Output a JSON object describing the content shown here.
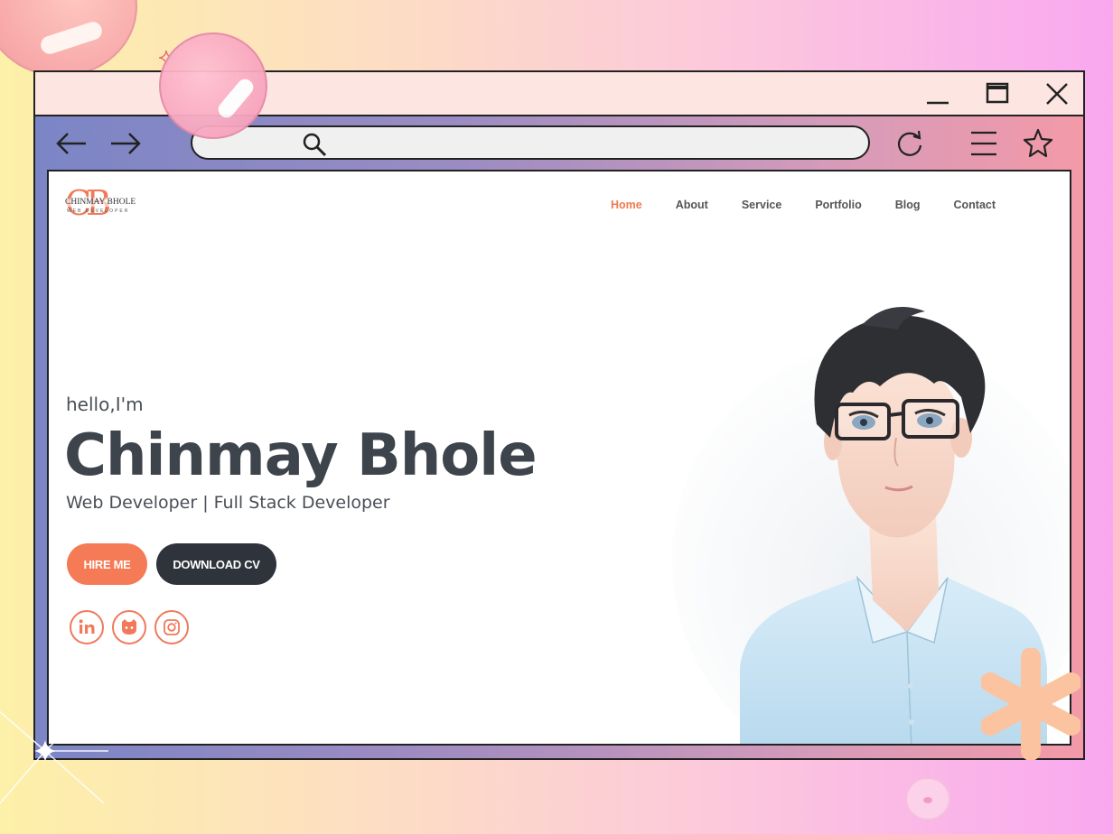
{
  "window": {
    "controls": [
      "minimize-icon",
      "maximize-icon",
      "close-icon"
    ]
  },
  "toolbar": {
    "icons": [
      "arrow-left-icon",
      "arrow-right-icon",
      "search-icon",
      "reload-icon",
      "menu-icon",
      "star-icon"
    ]
  },
  "site": {
    "logo": {
      "monogram": "CB",
      "name": "CHINMAY BHOLE",
      "tagline": "WEB DEVELOPER"
    },
    "nav": [
      {
        "label": "Home",
        "active": true
      },
      {
        "label": "About",
        "active": false
      },
      {
        "label": "Service",
        "active": false
      },
      {
        "label": "Portfolio",
        "active": false
      },
      {
        "label": "Blog",
        "active": false
      },
      {
        "label": "Contact",
        "active": false
      }
    ]
  },
  "hero": {
    "greeting": "hello,I'm",
    "name": "Chinmay Bhole",
    "role": "Web Developer | Full Stack Developer",
    "hire_label": "HIRE ME",
    "cv_label": "DOWNLOAD CV",
    "socials": [
      "linkedin-icon",
      "github-icon",
      "instagram-icon"
    ]
  },
  "colors": {
    "accent": "#f57a56",
    "dark": "#2f343c",
    "text": "#3e444c"
  }
}
